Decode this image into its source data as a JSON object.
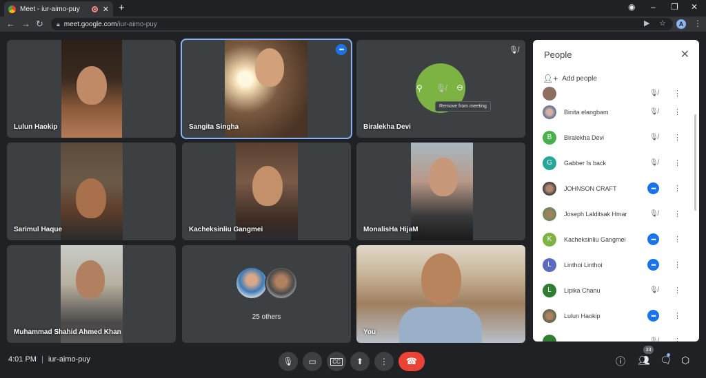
{
  "browser": {
    "tab_title": "Meet - iur-aimo-puy",
    "tab_close": "✕",
    "new_tab": "+",
    "url_host": "meet.google.com",
    "url_path": "/iur-aimo-puy",
    "profile_initial": "A"
  },
  "tiles": [
    {
      "name": "Lulun Haokip"
    },
    {
      "name": "Sangita Singha"
    },
    {
      "name": "Biralekha Devi",
      "tooltip": "Remove from meeting"
    },
    {
      "name": "Sarimul Haque"
    },
    {
      "name": "Kacheksinliu Gangmei"
    },
    {
      "name": "MonalisHa HijaM"
    },
    {
      "name": "Muhammad Shahid Ahmed Khan"
    },
    {
      "others_label": "25 others"
    },
    {
      "name": "You"
    }
  ],
  "people_panel": {
    "title": "People",
    "add_people": "Add people",
    "participants": [
      {
        "name": "Binita elangbam",
        "avatar": "photo",
        "state": "muted"
      },
      {
        "name": "Biralekha Devi",
        "avatar": "B",
        "color": "#4caf50",
        "state": "muted"
      },
      {
        "name": "Gabber Is back",
        "avatar": "G",
        "color": "#26a69a",
        "state": "muted"
      },
      {
        "name": "JOHNSON CRAFT",
        "avatar": "photo",
        "state": "more"
      },
      {
        "name": "Joseph Lalditsak Hmar",
        "avatar": "photo",
        "state": "muted"
      },
      {
        "name": "Kacheksinliu Gangmei",
        "avatar": "K",
        "color": "#7cb342",
        "state": "more"
      },
      {
        "name": "Linthoi Linthoi",
        "avatar": "L",
        "color": "#5c6bc0",
        "state": "more"
      },
      {
        "name": "Lipika Chanu",
        "avatar": "L",
        "color": "#2e7d32",
        "state": "muted"
      },
      {
        "name": "Lulun Haokip",
        "avatar": "photo",
        "state": "more"
      }
    ]
  },
  "bottom_bar": {
    "time": "4:01 PM",
    "meeting_code": "iur-aimo-puy",
    "participant_count": "33"
  },
  "colors": {
    "accent": "#1a73e8",
    "end_call": "#ea4335",
    "background": "#202124"
  }
}
